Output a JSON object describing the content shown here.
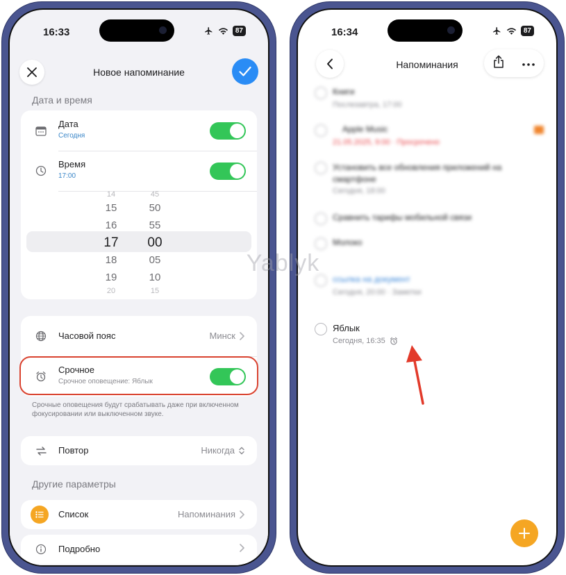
{
  "left": {
    "status": {
      "time": "16:33",
      "battery": "87"
    },
    "title": "Новое напоминание",
    "section_datetime": "Дата и время",
    "date": {
      "label": "Дата",
      "value": "Сегодня",
      "enabled": true
    },
    "time": {
      "label": "Время",
      "value": "17:00",
      "enabled": true
    },
    "picker": {
      "hours": [
        "14",
        "15",
        "16",
        "17",
        "18",
        "19",
        "20"
      ],
      "minutes": [
        "45",
        "50",
        "55",
        "00",
        "05",
        "10",
        "15"
      ]
    },
    "timezone": {
      "label": "Часовой пояс",
      "value": "Минск"
    },
    "urgent": {
      "label": "Срочное",
      "sub": "Срочное оповещение: Яблык",
      "enabled": true
    },
    "footnote": "Срочные оповещения будут срабатывать даже при включенном фокусировании или выключенном звуке.",
    "repeat": {
      "label": "Повтор",
      "value": "Никогда"
    },
    "section_other": "Другие параметры",
    "list": {
      "label": "Список",
      "value": "Напоминания"
    },
    "details": {
      "label": "Подробно"
    },
    "watermark": "Yablyk"
  },
  "right": {
    "status": {
      "time": "16:34",
      "battery": "87"
    },
    "title": "Напоминания",
    "tasks": [
      {
        "title": "Книги",
        "sub": "Послезавтра, 17:00",
        "blurred": true
      },
      {
        "title": "Apple Music",
        "sub": "21.05.2025, 9:00 · Просрочено",
        "blurred": true
      },
      {
        "title": "Установить все обновления приложений на смартфоне",
        "sub": "Сегодня, 18:00",
        "blurred": true
      },
      {
        "title": "Сравнить тарифы мобильной связи",
        "sub": "",
        "blurred": true
      },
      {
        "title": "Молоко",
        "sub": "",
        "blurred": true
      },
      {
        "title": "ссылка на документ",
        "sub": "Сегодня, 20:00 · Заметки",
        "blurred": true
      },
      {
        "title": "Яблык",
        "sub": "Сегодня, 16:35",
        "blurred": false
      }
    ]
  },
  "colors": {
    "accent_blue": "#2a8cf5",
    "toggle_green": "#33c658",
    "highlight_red": "#d9422f",
    "fab_orange": "#f5a623",
    "frame": "#4a5590"
  }
}
